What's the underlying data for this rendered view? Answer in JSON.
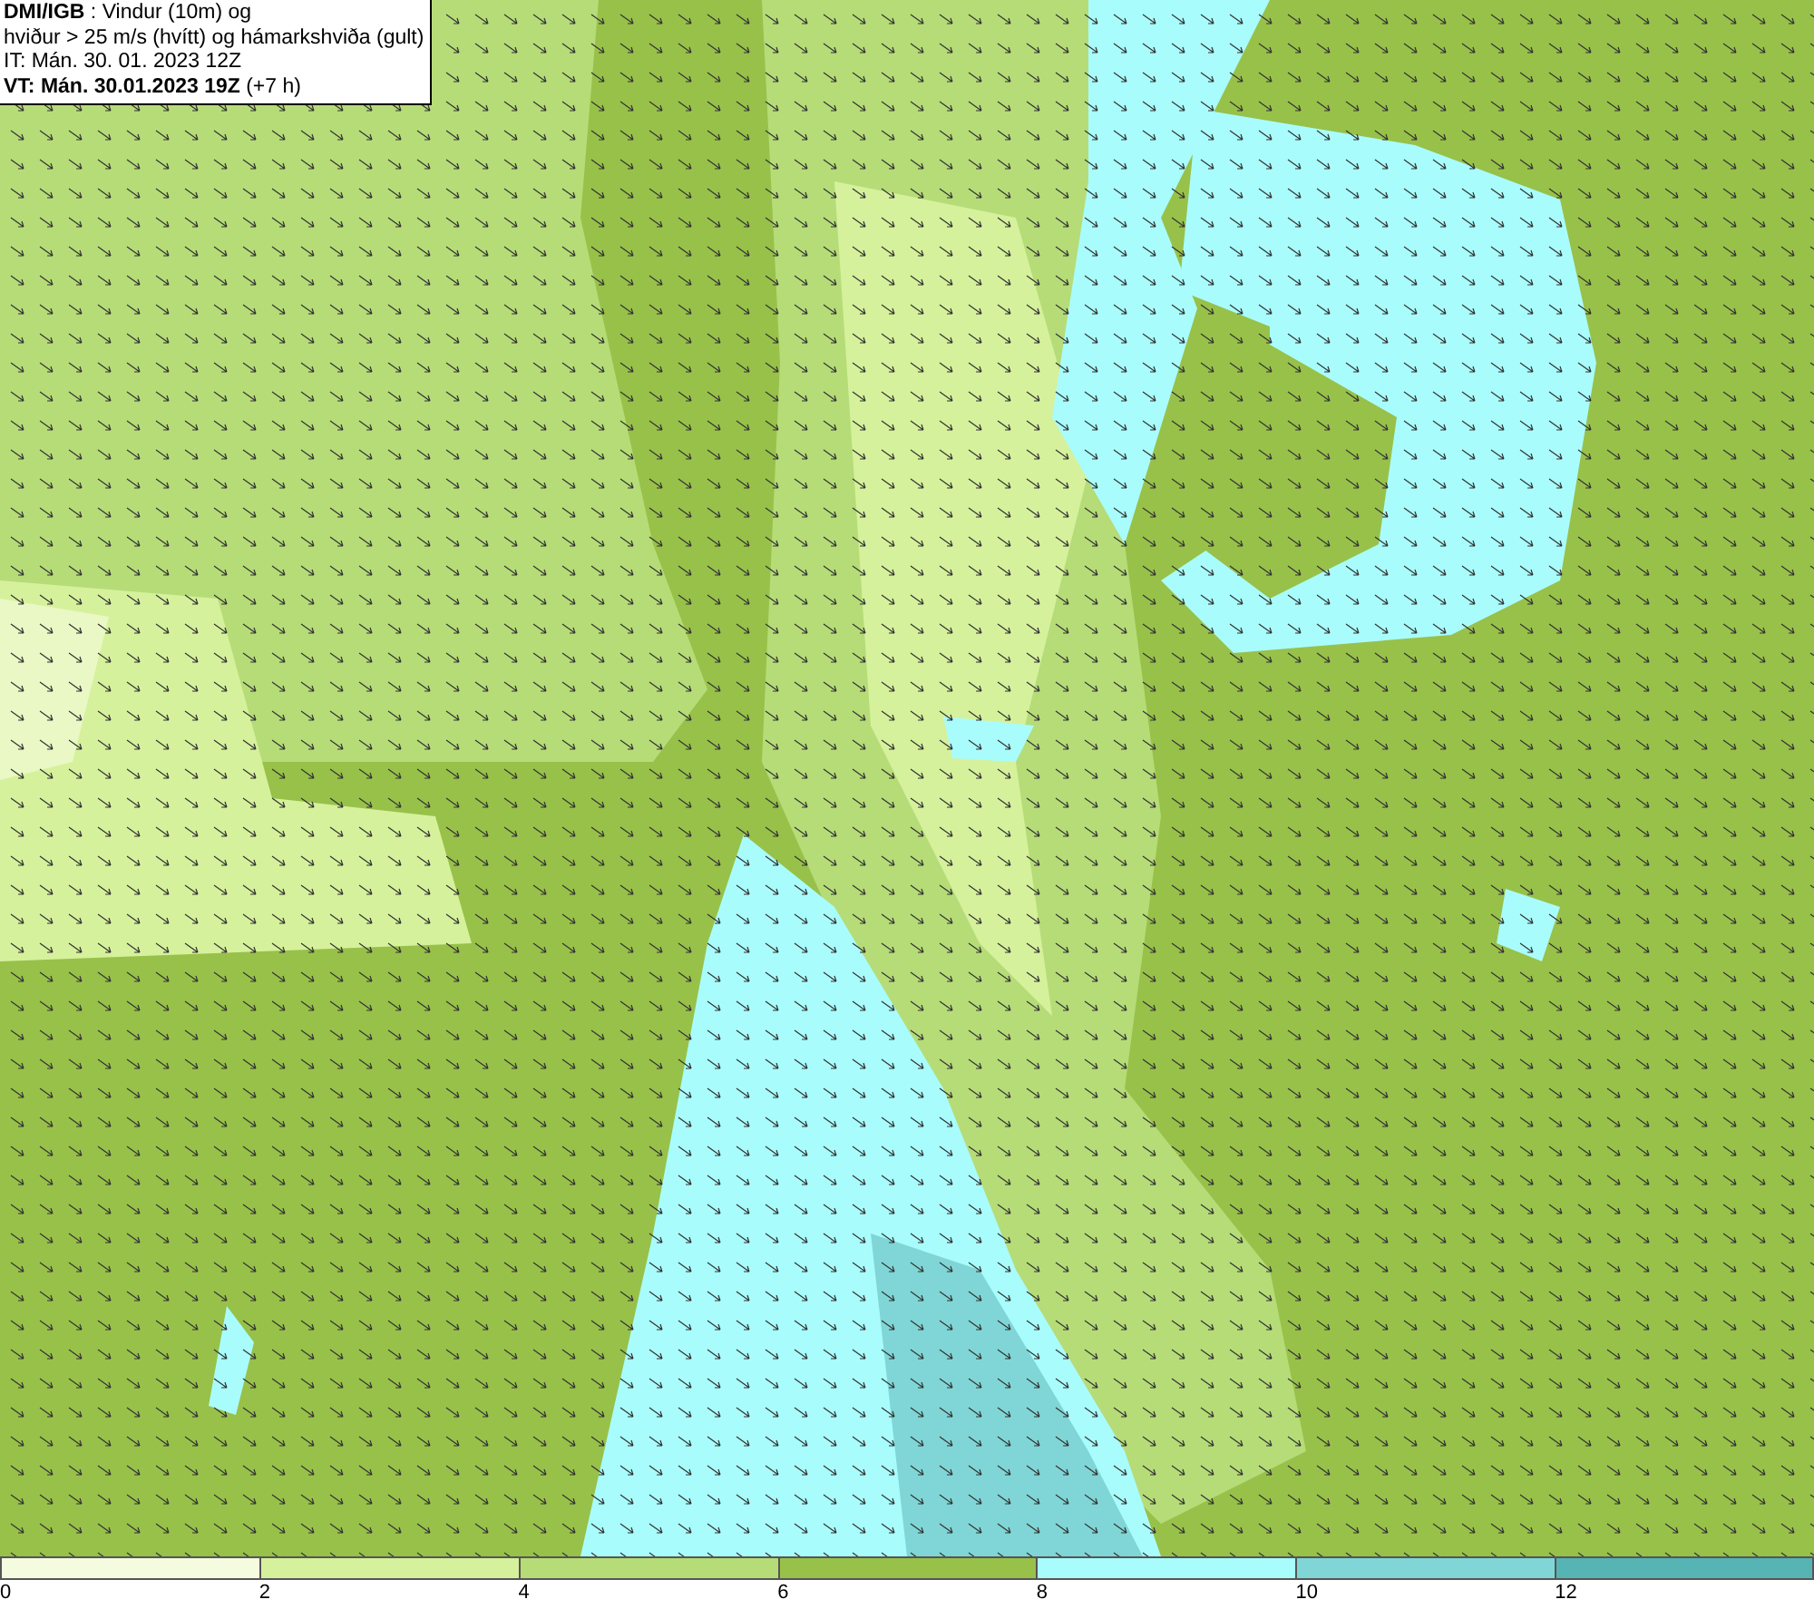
{
  "header": {
    "lines": [
      "**DMI/IGB** : Vindur (10m) og",
      "hviður > 25 m/s (hvítt) og hámarkshviða (gult)",
      "IT: Mán. 30. 01. 2023 12Z",
      "**VT: Mán. 30.01.2023 19Z** (+7 h)"
    ]
  },
  "legend": {
    "bins": [
      {
        "color": "#f4fbdf",
        "label": "0"
      },
      {
        "color": "#d6f19c",
        "label": "2"
      },
      {
        "color": "#b6dc78",
        "label": "4"
      },
      {
        "color": "#98c14a",
        "label": "6"
      },
      {
        "color": "#a9fcfc",
        "label": "8"
      },
      {
        "color": "#80d6d6",
        "label": "10"
      },
      {
        "color": "#56b4b4",
        "label": "12"
      }
    ]
  }
}
